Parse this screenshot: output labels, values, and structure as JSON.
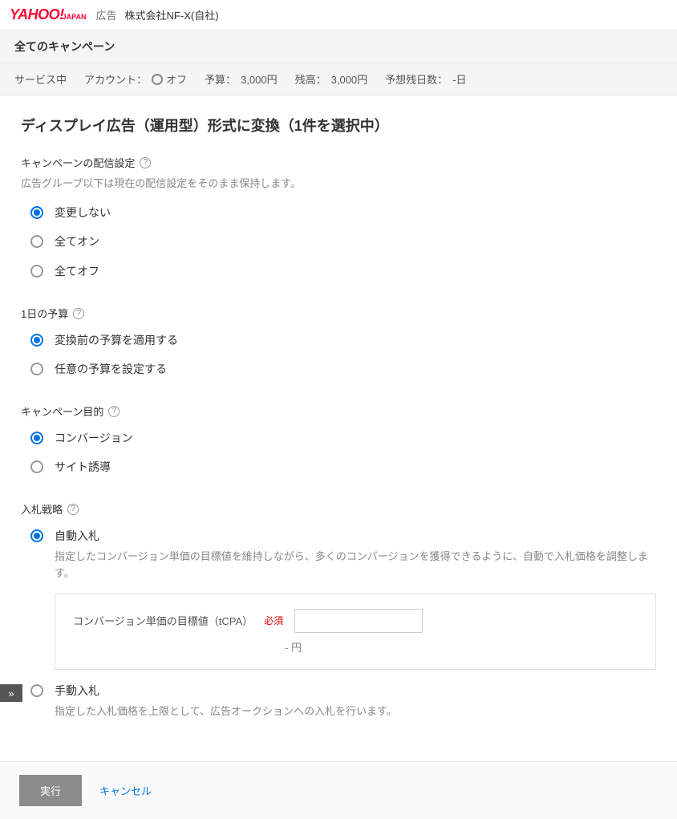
{
  "header": {
    "logo_main": "YAHOO!",
    "logo_sub": "JAPAN",
    "logo_ad": "広告",
    "company": "株式会社NF-X(自社)"
  },
  "subheader": {
    "title": "全てのキャンペーン"
  },
  "statusbar": {
    "service": "サービス中",
    "account_label": "アカウント：",
    "account_state": "オフ",
    "budget_label": "予算：",
    "budget_value": "3,000円",
    "balance_label": "残高：",
    "balance_value": "3,000円",
    "days_label": "予想残日数：",
    "days_value": "-日"
  },
  "page": {
    "title": "ディスプレイ広告（運用型）形式に変換（1件を選択中）"
  },
  "delivery": {
    "label": "キャンペーンの配信設定",
    "desc": "広告グループ以下は現在の配信設定をそのまま保持します。",
    "options": {
      "no_change": "変更しない",
      "all_on": "全てオン",
      "all_off": "全てオフ"
    }
  },
  "budget": {
    "label": "1日の予算",
    "options": {
      "apply_prev": "変換前の予算を適用する",
      "set_custom": "任意の予算を設定する"
    }
  },
  "purpose": {
    "label": "キャンペーン目的",
    "options": {
      "conversion": "コンバージョン",
      "site_visit": "サイト誘導"
    }
  },
  "bidding": {
    "label": "入札戦略",
    "auto": {
      "label": "自動入札",
      "desc": "指定したコンバージョン単価の目標値を維持しながら、多くのコンバージョンを獲得できるように、自動で入札価格を調整します。",
      "tcpa_label": "コンバージョン単価の目標値（tCPA）",
      "required": "必須",
      "unit": "- 円"
    },
    "manual": {
      "label": "手動入札",
      "desc": "指定した入札価格を上限として、広告オークションへの入札を行います。"
    }
  },
  "footer": {
    "submit": "実行",
    "cancel": "キャンセル"
  },
  "icons": {
    "help": "?",
    "chevrons": "»"
  }
}
